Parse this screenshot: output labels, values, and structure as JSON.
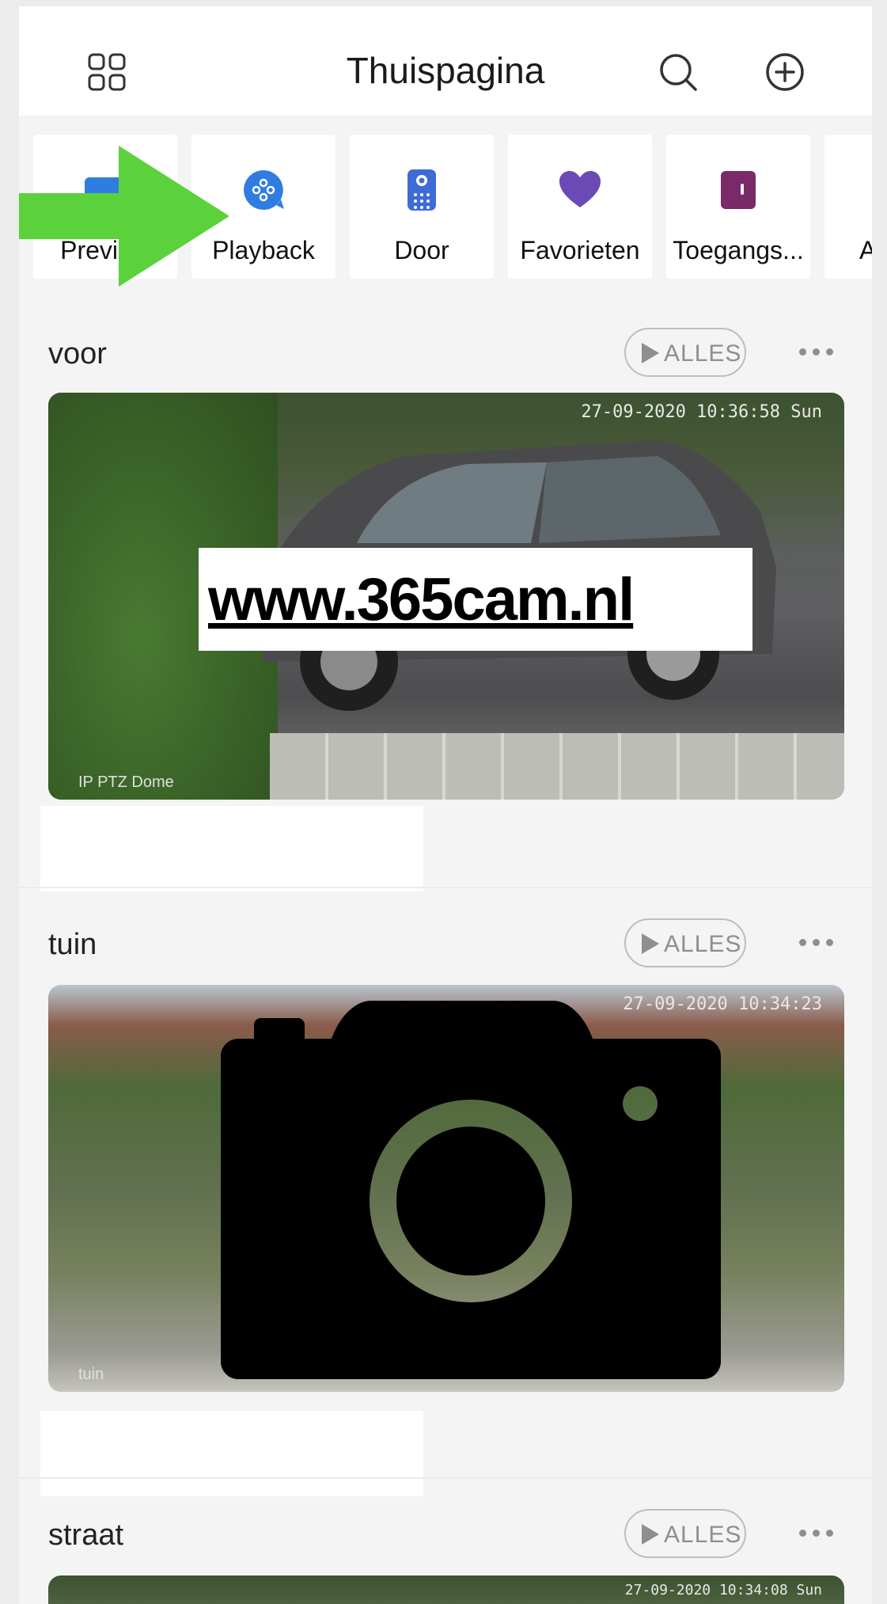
{
  "header": {
    "title": "Thuispagina",
    "icons": {
      "menu": "grid-icon",
      "search": "search-icon",
      "add": "plus-circle-icon"
    }
  },
  "shortcuts": [
    {
      "label": "Preview",
      "icon": "preview-icon",
      "color": "#2f7de1"
    },
    {
      "label": "Playback",
      "icon": "playback-icon",
      "color": "#2f7de1"
    },
    {
      "label": "Door",
      "icon": "doorbell-icon",
      "color": "#3f6bd6"
    },
    {
      "label": "Favorieten",
      "icon": "heart-icon",
      "color": "#6a4bb5"
    },
    {
      "label": "Toegangs...",
      "icon": "access-card-icon",
      "color": "#7a2a68"
    },
    {
      "label": "A",
      "icon": "more-shortcut-icon",
      "color": "#888888"
    }
  ],
  "annotation": {
    "arrow_color": "#5bd13b",
    "icon": "green-arrow-icon"
  },
  "sections": [
    {
      "title": "voor",
      "alles_label": "ALLES",
      "camera": {
        "timestamp": "27-09-2020 10:36:58 Sun",
        "name_overlay": "IP PTZ Dome"
      },
      "watermark": "www.365cam.nl"
    },
    {
      "title": "tuin",
      "alles_label": "ALLES",
      "camera": {
        "timestamp": "27-09-2020 10:34:23",
        "name_overlay": "tuin"
      },
      "overlay_icon": "camera-icon"
    },
    {
      "title": "straat",
      "alles_label": "ALLES",
      "camera": {
        "timestamp": "27-09-2020 10:34:08 Sun"
      }
    }
  ]
}
